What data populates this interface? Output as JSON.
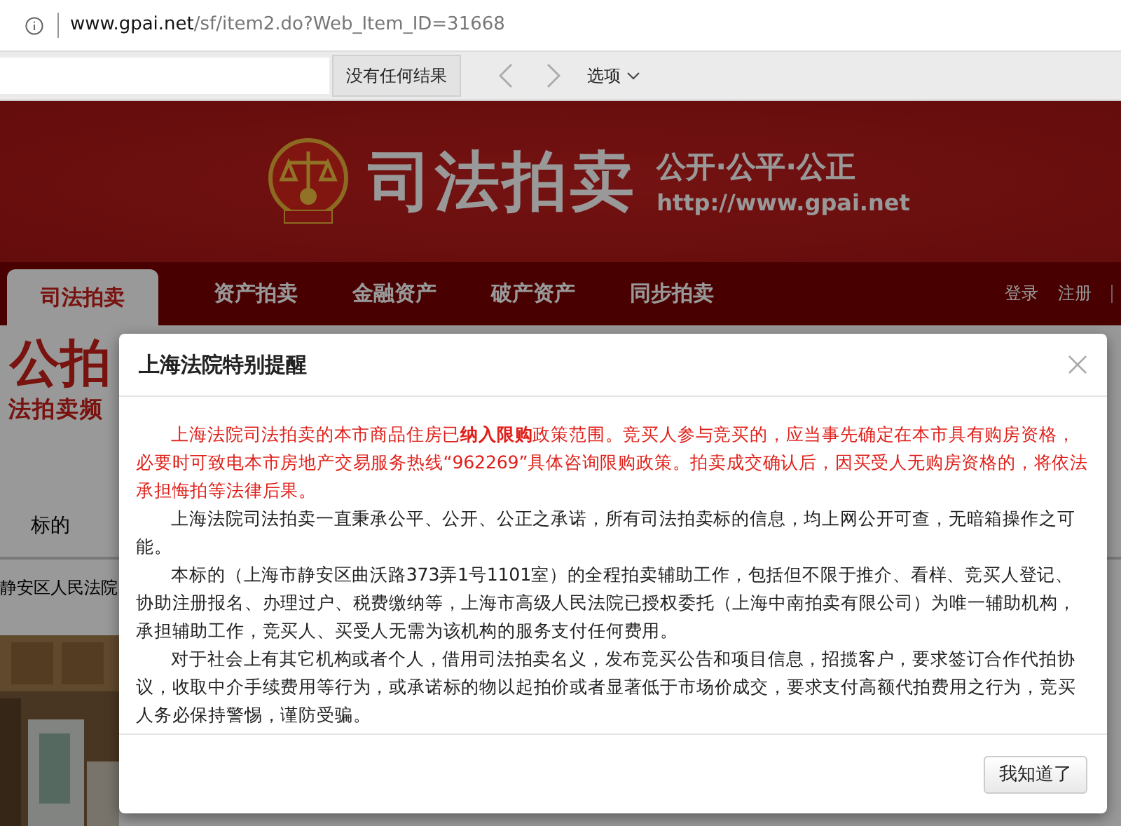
{
  "address_bar": {
    "host": "www.gpai.net",
    "path": "/sf/item2.do?Web_Item_ID=31668"
  },
  "find_bar": {
    "result": "没有任何结果",
    "options": "选项"
  },
  "header": {
    "title": "司法拍卖",
    "slogan": "公开·公平·公正",
    "url": "http://www.gpai.net"
  },
  "nav": {
    "items": [
      {
        "label": "司法拍卖",
        "selected": true
      },
      {
        "label": "资产拍卖",
        "selected": false
      },
      {
        "label": "金融资产",
        "selected": false
      },
      {
        "label": "破产资产",
        "selected": false
      },
      {
        "label": "同步拍卖",
        "selected": false
      }
    ],
    "links": [
      "登录",
      "注册"
    ]
  },
  "page": {
    "logo": "公拍",
    "logo_sub": "法拍卖频",
    "tab": "标的",
    "court": "静安区人民法院"
  },
  "dialog": {
    "title": "上海法院特别提醒",
    "paragraphs": [
      {
        "kind": "warning",
        "text": "上海法院司法拍卖的本市商品住房已**纳入限购**政策范围。竞买人参与竞买的，应当事先确定在本市具有购房资格，必要时可致电本市房地产交易服务热线“962269”具体咨询限购政策。拍卖成交确认后，因买受人无购房资格的，将依法承担悔拍等法律后果。"
      },
      {
        "kind": "normal",
        "text": "上海法院司法拍卖一直秉承公平、公开、公正之承诺，所有司法拍卖标的信息，均上网公开可查，无暗箱操作之可能。"
      },
      {
        "kind": "normal",
        "text": "本标的（上海市静安区曲沃路373弄1号1101室）的全程拍卖辅助工作，包括但不限于推介、看样、竞买人登记、协助注册报名、办理过户、税费缴纳等，上海市高级人民法院已授权委托（上海中南拍卖有限公司）为唯一辅助机构，承担辅助工作，竞买人、买受人无需为该机构的服务支付任何费用。"
      },
      {
        "kind": "normal",
        "text": "对于社会上有其它机构或者个人，借用司法拍卖名义，发布竞买公告和项目信息，招揽客户，要求签订合作代拍协议，收取中介手续费用等行为，或承诺标的物以起拍价或者显著低于市场价成交，要求支付高额代拍费用之行为，竞买人务必保持警惕，谨防受骗。"
      }
    ],
    "button": "我知道了"
  }
}
